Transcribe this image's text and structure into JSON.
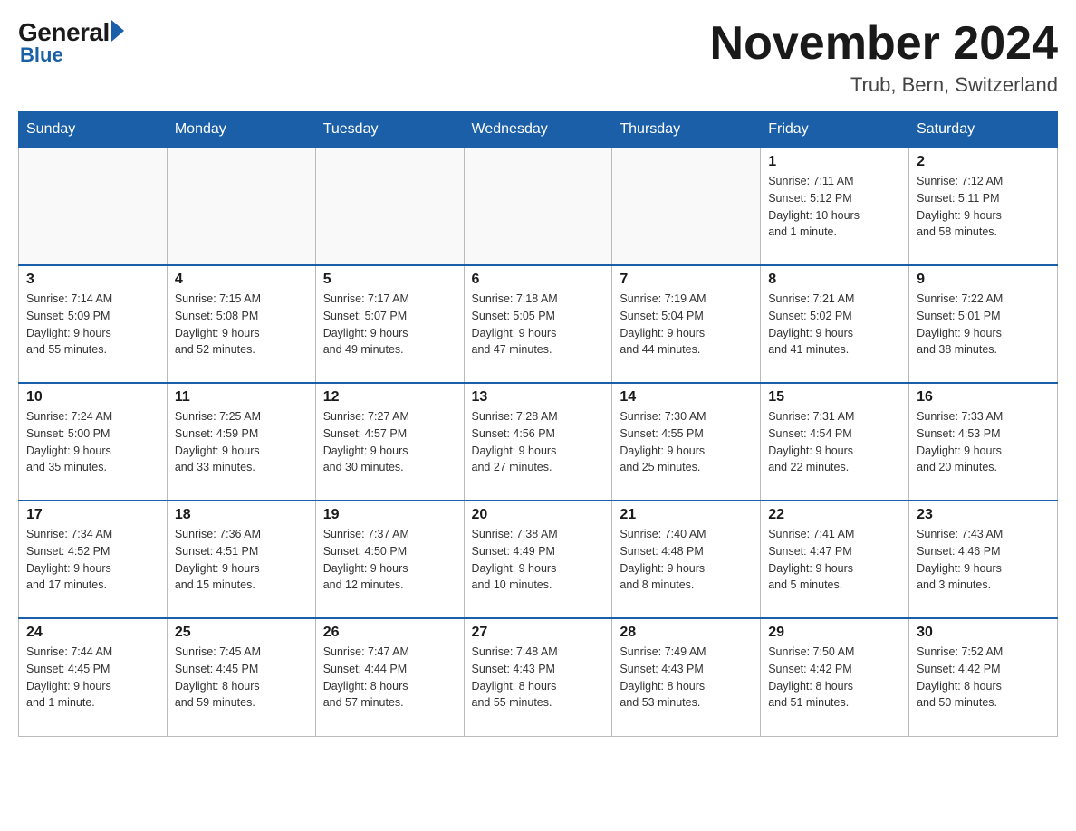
{
  "logo": {
    "general": "General",
    "blue": "Blue"
  },
  "title": "November 2024",
  "location": "Trub, Bern, Switzerland",
  "weekdays": [
    "Sunday",
    "Monday",
    "Tuesday",
    "Wednesday",
    "Thursday",
    "Friday",
    "Saturday"
  ],
  "weeks": [
    [
      {
        "day": "",
        "info": ""
      },
      {
        "day": "",
        "info": ""
      },
      {
        "day": "",
        "info": ""
      },
      {
        "day": "",
        "info": ""
      },
      {
        "day": "",
        "info": ""
      },
      {
        "day": "1",
        "info": "Sunrise: 7:11 AM\nSunset: 5:12 PM\nDaylight: 10 hours\nand 1 minute."
      },
      {
        "day": "2",
        "info": "Sunrise: 7:12 AM\nSunset: 5:11 PM\nDaylight: 9 hours\nand 58 minutes."
      }
    ],
    [
      {
        "day": "3",
        "info": "Sunrise: 7:14 AM\nSunset: 5:09 PM\nDaylight: 9 hours\nand 55 minutes."
      },
      {
        "day": "4",
        "info": "Sunrise: 7:15 AM\nSunset: 5:08 PM\nDaylight: 9 hours\nand 52 minutes."
      },
      {
        "day": "5",
        "info": "Sunrise: 7:17 AM\nSunset: 5:07 PM\nDaylight: 9 hours\nand 49 minutes."
      },
      {
        "day": "6",
        "info": "Sunrise: 7:18 AM\nSunset: 5:05 PM\nDaylight: 9 hours\nand 47 minutes."
      },
      {
        "day": "7",
        "info": "Sunrise: 7:19 AM\nSunset: 5:04 PM\nDaylight: 9 hours\nand 44 minutes."
      },
      {
        "day": "8",
        "info": "Sunrise: 7:21 AM\nSunset: 5:02 PM\nDaylight: 9 hours\nand 41 minutes."
      },
      {
        "day": "9",
        "info": "Sunrise: 7:22 AM\nSunset: 5:01 PM\nDaylight: 9 hours\nand 38 minutes."
      }
    ],
    [
      {
        "day": "10",
        "info": "Sunrise: 7:24 AM\nSunset: 5:00 PM\nDaylight: 9 hours\nand 35 minutes."
      },
      {
        "day": "11",
        "info": "Sunrise: 7:25 AM\nSunset: 4:59 PM\nDaylight: 9 hours\nand 33 minutes."
      },
      {
        "day": "12",
        "info": "Sunrise: 7:27 AM\nSunset: 4:57 PM\nDaylight: 9 hours\nand 30 minutes."
      },
      {
        "day": "13",
        "info": "Sunrise: 7:28 AM\nSunset: 4:56 PM\nDaylight: 9 hours\nand 27 minutes."
      },
      {
        "day": "14",
        "info": "Sunrise: 7:30 AM\nSunset: 4:55 PM\nDaylight: 9 hours\nand 25 minutes."
      },
      {
        "day": "15",
        "info": "Sunrise: 7:31 AM\nSunset: 4:54 PM\nDaylight: 9 hours\nand 22 minutes."
      },
      {
        "day": "16",
        "info": "Sunrise: 7:33 AM\nSunset: 4:53 PM\nDaylight: 9 hours\nand 20 minutes."
      }
    ],
    [
      {
        "day": "17",
        "info": "Sunrise: 7:34 AM\nSunset: 4:52 PM\nDaylight: 9 hours\nand 17 minutes."
      },
      {
        "day": "18",
        "info": "Sunrise: 7:36 AM\nSunset: 4:51 PM\nDaylight: 9 hours\nand 15 minutes."
      },
      {
        "day": "19",
        "info": "Sunrise: 7:37 AM\nSunset: 4:50 PM\nDaylight: 9 hours\nand 12 minutes."
      },
      {
        "day": "20",
        "info": "Sunrise: 7:38 AM\nSunset: 4:49 PM\nDaylight: 9 hours\nand 10 minutes."
      },
      {
        "day": "21",
        "info": "Sunrise: 7:40 AM\nSunset: 4:48 PM\nDaylight: 9 hours\nand 8 minutes."
      },
      {
        "day": "22",
        "info": "Sunrise: 7:41 AM\nSunset: 4:47 PM\nDaylight: 9 hours\nand 5 minutes."
      },
      {
        "day": "23",
        "info": "Sunrise: 7:43 AM\nSunset: 4:46 PM\nDaylight: 9 hours\nand 3 minutes."
      }
    ],
    [
      {
        "day": "24",
        "info": "Sunrise: 7:44 AM\nSunset: 4:45 PM\nDaylight: 9 hours\nand 1 minute."
      },
      {
        "day": "25",
        "info": "Sunrise: 7:45 AM\nSunset: 4:45 PM\nDaylight: 8 hours\nand 59 minutes."
      },
      {
        "day": "26",
        "info": "Sunrise: 7:47 AM\nSunset: 4:44 PM\nDaylight: 8 hours\nand 57 minutes."
      },
      {
        "day": "27",
        "info": "Sunrise: 7:48 AM\nSunset: 4:43 PM\nDaylight: 8 hours\nand 55 minutes."
      },
      {
        "day": "28",
        "info": "Sunrise: 7:49 AM\nSunset: 4:43 PM\nDaylight: 8 hours\nand 53 minutes."
      },
      {
        "day": "29",
        "info": "Sunrise: 7:50 AM\nSunset: 4:42 PM\nDaylight: 8 hours\nand 51 minutes."
      },
      {
        "day": "30",
        "info": "Sunrise: 7:52 AM\nSunset: 4:42 PM\nDaylight: 8 hours\nand 50 minutes."
      }
    ]
  ]
}
